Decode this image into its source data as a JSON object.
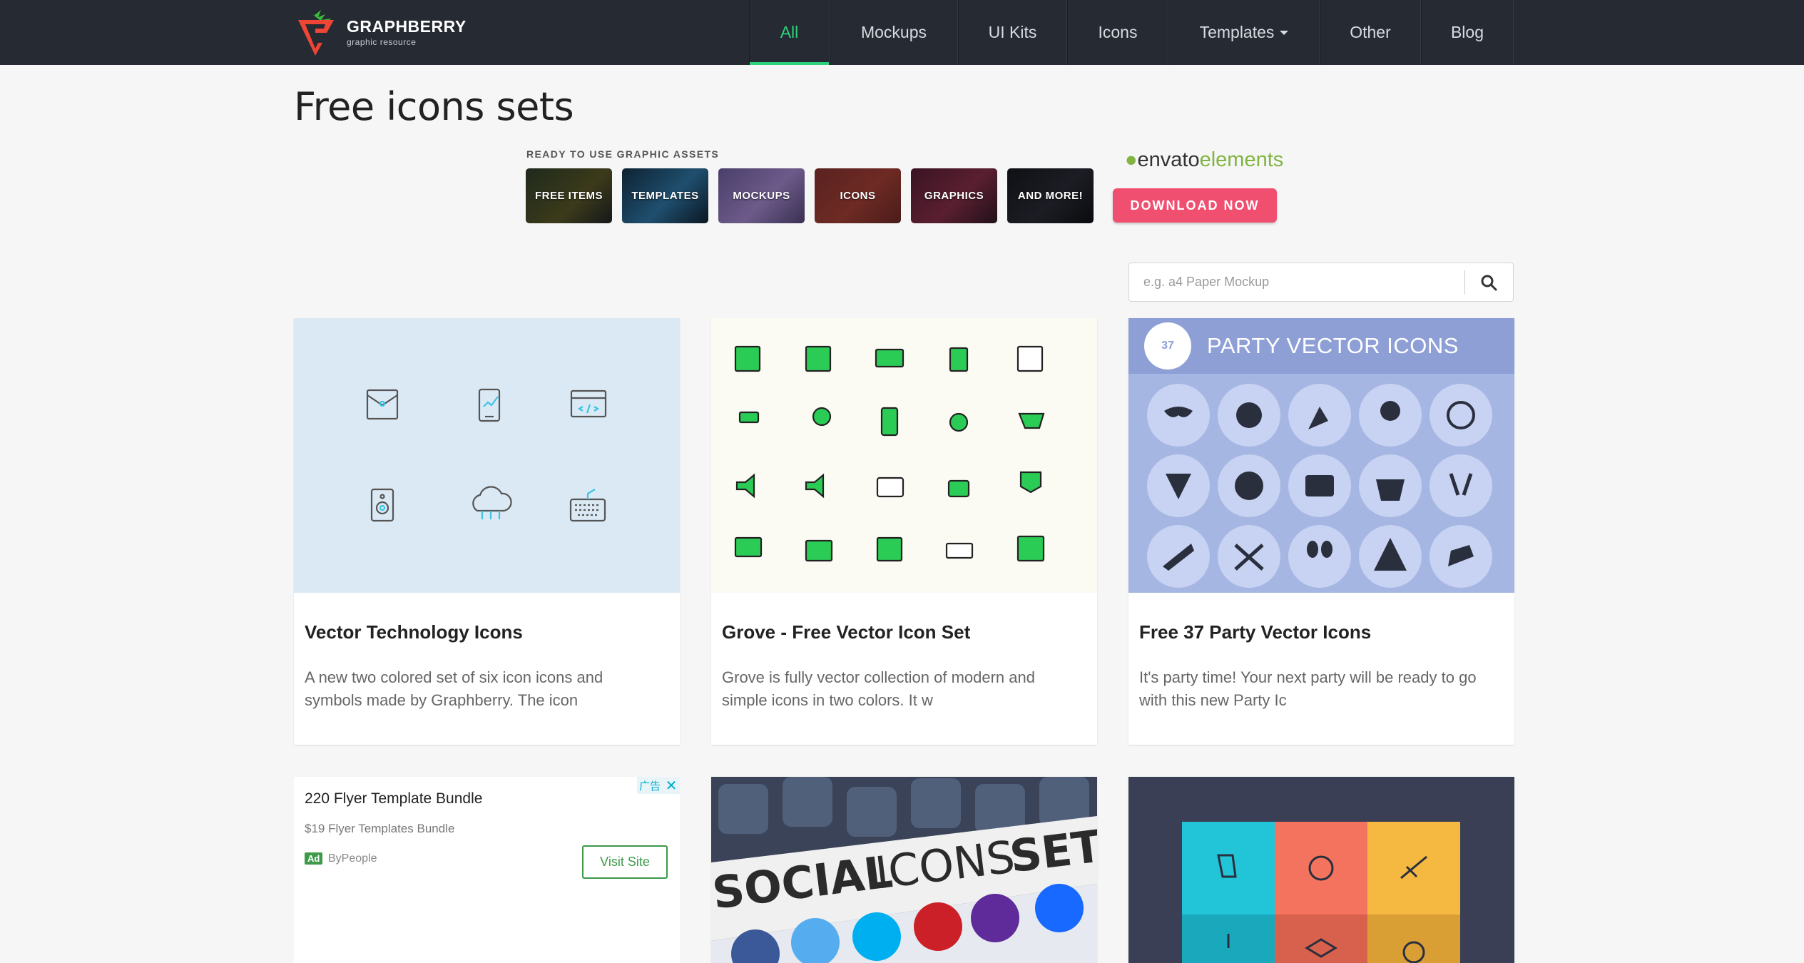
{
  "site": {
    "name": "GRAPHBERRY",
    "tagline": "graphic resource"
  },
  "nav": {
    "items": [
      {
        "label": "All",
        "active": true
      },
      {
        "label": "Mockups",
        "active": false
      },
      {
        "label": "UI Kits",
        "active": false
      },
      {
        "label": "Icons",
        "active": false
      },
      {
        "label": "Templates",
        "active": false,
        "has_dropdown": true
      },
      {
        "label": "Other",
        "active": false
      },
      {
        "label": "Blog",
        "active": false
      }
    ]
  },
  "page": {
    "title": "Free icons sets"
  },
  "banner": {
    "label": "READY TO USE GRAPHIC ASSETS",
    "tiles": [
      "FREE ITEMS",
      "TEMPLATES",
      "MOCKUPS",
      "ICONS",
      "GRAPHICS",
      "AND MORE!"
    ],
    "brand_main": "envato",
    "brand_suffix": "elements",
    "cta": "DOWNLOAD NOW"
  },
  "search": {
    "placeholder": "e.g. a4 Paper Mockup",
    "icon": "search-icon"
  },
  "cards": [
    {
      "title": "Vector Technology Icons",
      "description": "A new two colored set of six icon icons and symbols made by Graphberry. The icon"
    },
    {
      "title": "Grove - Free Vector Icon Set",
      "description": "Grove is fully vector collection of modern and simple icons in two colors. It w"
    },
    {
      "title": "Free 37 Party Vector Icons",
      "description": "It's party time! Your next party will be ready to go with this new Party Ic",
      "thumb_heading": "PARTY VECTOR ICONS",
      "thumb_badge": "37"
    }
  ],
  "ad": {
    "title": "220 Flyer Template Bundle",
    "subtitle": "$19 Flyer Templates Bundle",
    "badge": "Ad",
    "advertiser": "ByPeople",
    "cta": "Visit Site",
    "mark": "广告"
  },
  "social_card": {
    "word1": "SOCIAL",
    "word2": "ICONS",
    "word3": "SET"
  },
  "colors": {
    "header_bg": "#252a33",
    "accent_green": "#2fd27c",
    "cta_pink": "#f14f70",
    "tech_bg": "#dbe9f4",
    "grove_bg": "#fbfbf4",
    "party_bg": "#a6b6e2",
    "party_header": "#8e9fd6",
    "flat_bg": "#3a3f55"
  }
}
